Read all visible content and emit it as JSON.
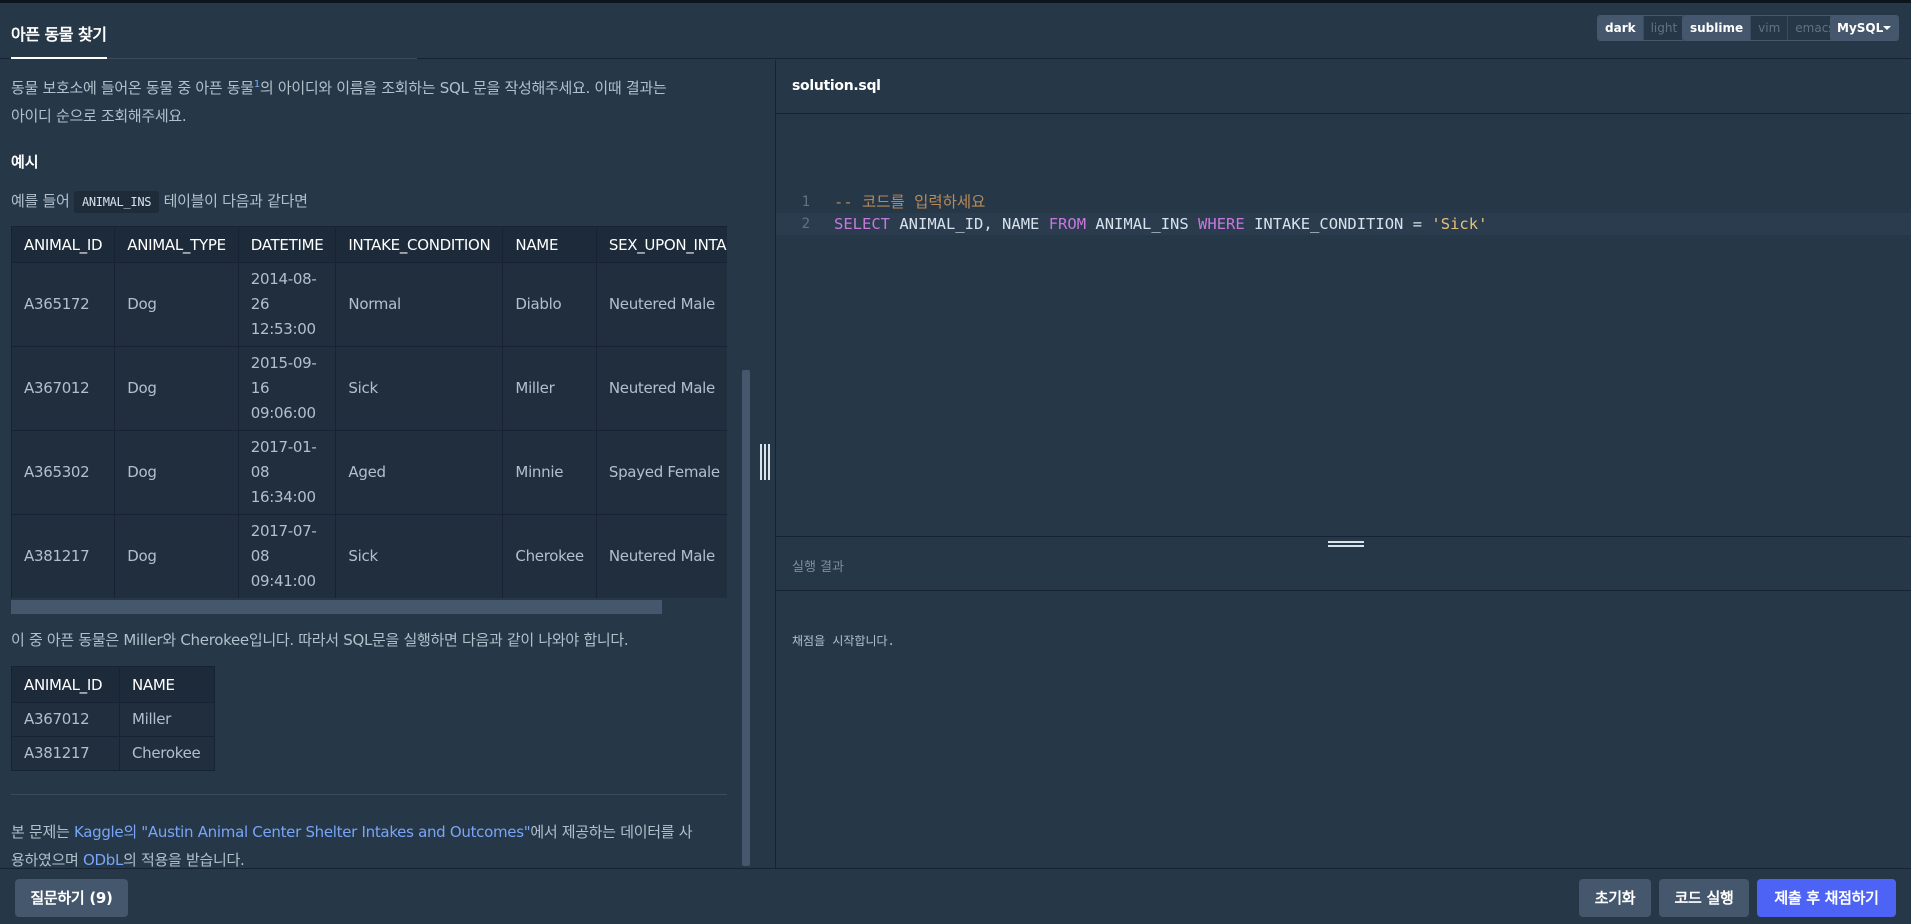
{
  "header": {
    "title": "아픈 동물 찾기",
    "theme_options": [
      "dark",
      "light"
    ],
    "theme_active": "dark",
    "keymap_options": [
      "sublime",
      "vim",
      "emacs"
    ],
    "keymap_active": "sublime",
    "language": "MySQL"
  },
  "problem": {
    "description_part1": "동물 보호소에 들어온 동물 중 아픈 동물",
    "footnote_mark": "1",
    "description_part2": "의 아이디와 이름을 조회하는 SQL 문을 작성해주세요. 이때 결과는",
    "description_line2": "아이디 순으로 조회해주세요.",
    "example_heading": "예시",
    "example_intro_before": "예를 들어",
    "example_table_name": "ANIMAL_INS",
    "example_intro_after": "테이블이 다음과 같다면",
    "input_table": {
      "headers": [
        "ANIMAL_ID",
        "ANIMAL_TYPE",
        "DATETIME",
        "INTAKE_CONDITION",
        "NAME",
        "SEX_UPON_INTAKE"
      ],
      "rows": [
        [
          "A365172",
          "Dog",
          "2014-08-26 12:53:00",
          "Normal",
          "Diablo",
          "Neutered Male"
        ],
        [
          "A367012",
          "Dog",
          "2015-09-16 09:06:00",
          "Sick",
          "Miller",
          "Neutered Male"
        ],
        [
          "A365302",
          "Dog",
          "2017-01-08 16:34:00",
          "Aged",
          "Minnie",
          "Spayed Female"
        ],
        [
          "A381217",
          "Dog",
          "2017-07-08 09:41:00",
          "Sick",
          "Cherokee",
          "Neutered Male"
        ]
      ]
    },
    "result_explanation": "이 중 아픈 동물은 Miller와 Cherokee입니다. 따라서 SQL문을 실행하면 다음과 같이 나와야 합니다.",
    "output_table": {
      "headers": [
        "ANIMAL_ID",
        "NAME"
      ],
      "rows": [
        [
          "A367012",
          "Miller"
        ],
        [
          "A381217",
          "Cherokee"
        ]
      ]
    },
    "source_before": "본 문제는",
    "source_link": "Kaggle의 \"Austin Animal Center Shelter Intakes and Outcomes\"",
    "source_after": "에서 제공하는 데이터를 사",
    "source_line2_before": "용하였으며",
    "license_link": "ODbL",
    "source_line2_after": "의 적용을 받습니다."
  },
  "editor": {
    "filename": "solution.sql",
    "lines": [
      {
        "number": "1",
        "text": "-- 코드를 입력하세요"
      },
      {
        "number": "2",
        "text": "SELECT ANIMAL_ID, NAME FROM ANIMAL_INS WHERE INTAKE_CONDITION = 'Sick'"
      }
    ]
  },
  "result": {
    "heading": "실행 결과",
    "message": "채점을 시작합니다."
  },
  "footer": {
    "question_button": "질문하기 (9)",
    "reset_button": "초기화",
    "run_button": "코드 실행",
    "submit_button": "제출 후 채점하기"
  },
  "colors": {
    "background": "#263747",
    "keyword": "#c678dd",
    "string": "#e5c07b",
    "comment": "#b88a5a",
    "link": "#78a5f7",
    "submit": "#4c63f5"
  }
}
